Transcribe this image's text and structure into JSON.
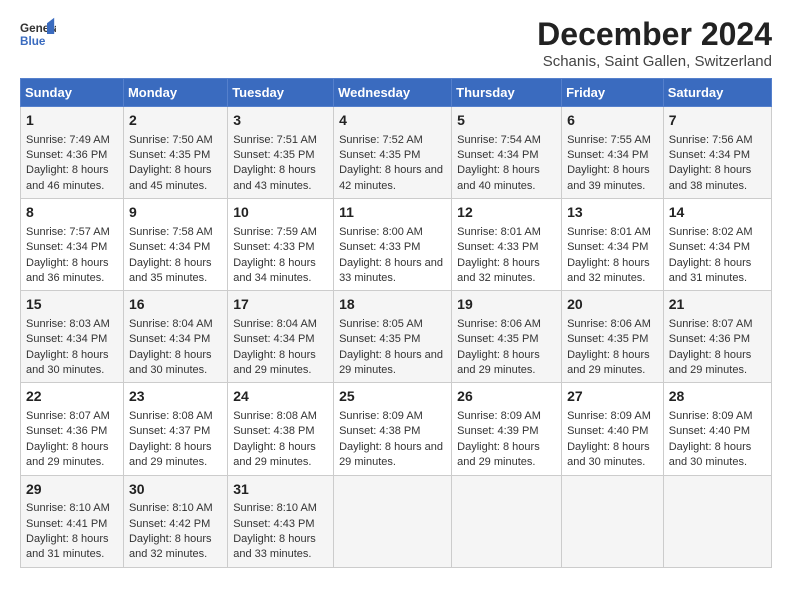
{
  "logo": {
    "text_general": "General",
    "text_blue": "Blue"
  },
  "title": "December 2024",
  "subtitle": "Schanis, Saint Gallen, Switzerland",
  "days_of_week": [
    "Sunday",
    "Monday",
    "Tuesday",
    "Wednesday",
    "Thursday",
    "Friday",
    "Saturday"
  ],
  "weeks": [
    [
      {
        "day": "1",
        "sunrise": "Sunrise: 7:49 AM",
        "sunset": "Sunset: 4:36 PM",
        "daylight": "Daylight: 8 hours and 46 minutes."
      },
      {
        "day": "2",
        "sunrise": "Sunrise: 7:50 AM",
        "sunset": "Sunset: 4:35 PM",
        "daylight": "Daylight: 8 hours and 45 minutes."
      },
      {
        "day": "3",
        "sunrise": "Sunrise: 7:51 AM",
        "sunset": "Sunset: 4:35 PM",
        "daylight": "Daylight: 8 hours and 43 minutes."
      },
      {
        "day": "4",
        "sunrise": "Sunrise: 7:52 AM",
        "sunset": "Sunset: 4:35 PM",
        "daylight": "Daylight: 8 hours and 42 minutes."
      },
      {
        "day": "5",
        "sunrise": "Sunrise: 7:54 AM",
        "sunset": "Sunset: 4:34 PM",
        "daylight": "Daylight: 8 hours and 40 minutes."
      },
      {
        "day": "6",
        "sunrise": "Sunrise: 7:55 AM",
        "sunset": "Sunset: 4:34 PM",
        "daylight": "Daylight: 8 hours and 39 minutes."
      },
      {
        "day": "7",
        "sunrise": "Sunrise: 7:56 AM",
        "sunset": "Sunset: 4:34 PM",
        "daylight": "Daylight: 8 hours and 38 minutes."
      }
    ],
    [
      {
        "day": "8",
        "sunrise": "Sunrise: 7:57 AM",
        "sunset": "Sunset: 4:34 PM",
        "daylight": "Daylight: 8 hours and 36 minutes."
      },
      {
        "day": "9",
        "sunrise": "Sunrise: 7:58 AM",
        "sunset": "Sunset: 4:34 PM",
        "daylight": "Daylight: 8 hours and 35 minutes."
      },
      {
        "day": "10",
        "sunrise": "Sunrise: 7:59 AM",
        "sunset": "Sunset: 4:33 PM",
        "daylight": "Daylight: 8 hours and 34 minutes."
      },
      {
        "day": "11",
        "sunrise": "Sunrise: 8:00 AM",
        "sunset": "Sunset: 4:33 PM",
        "daylight": "Daylight: 8 hours and 33 minutes."
      },
      {
        "day": "12",
        "sunrise": "Sunrise: 8:01 AM",
        "sunset": "Sunset: 4:33 PM",
        "daylight": "Daylight: 8 hours and 32 minutes."
      },
      {
        "day": "13",
        "sunrise": "Sunrise: 8:01 AM",
        "sunset": "Sunset: 4:34 PM",
        "daylight": "Daylight: 8 hours and 32 minutes."
      },
      {
        "day": "14",
        "sunrise": "Sunrise: 8:02 AM",
        "sunset": "Sunset: 4:34 PM",
        "daylight": "Daylight: 8 hours and 31 minutes."
      }
    ],
    [
      {
        "day": "15",
        "sunrise": "Sunrise: 8:03 AM",
        "sunset": "Sunset: 4:34 PM",
        "daylight": "Daylight: 8 hours and 30 minutes."
      },
      {
        "day": "16",
        "sunrise": "Sunrise: 8:04 AM",
        "sunset": "Sunset: 4:34 PM",
        "daylight": "Daylight: 8 hours and 30 minutes."
      },
      {
        "day": "17",
        "sunrise": "Sunrise: 8:04 AM",
        "sunset": "Sunset: 4:34 PM",
        "daylight": "Daylight: 8 hours and 29 minutes."
      },
      {
        "day": "18",
        "sunrise": "Sunrise: 8:05 AM",
        "sunset": "Sunset: 4:35 PM",
        "daylight": "Daylight: 8 hours and 29 minutes."
      },
      {
        "day": "19",
        "sunrise": "Sunrise: 8:06 AM",
        "sunset": "Sunset: 4:35 PM",
        "daylight": "Daylight: 8 hours and 29 minutes."
      },
      {
        "day": "20",
        "sunrise": "Sunrise: 8:06 AM",
        "sunset": "Sunset: 4:35 PM",
        "daylight": "Daylight: 8 hours and 29 minutes."
      },
      {
        "day": "21",
        "sunrise": "Sunrise: 8:07 AM",
        "sunset": "Sunset: 4:36 PM",
        "daylight": "Daylight: 8 hours and 29 minutes."
      }
    ],
    [
      {
        "day": "22",
        "sunrise": "Sunrise: 8:07 AM",
        "sunset": "Sunset: 4:36 PM",
        "daylight": "Daylight: 8 hours and 29 minutes."
      },
      {
        "day": "23",
        "sunrise": "Sunrise: 8:08 AM",
        "sunset": "Sunset: 4:37 PM",
        "daylight": "Daylight: 8 hours and 29 minutes."
      },
      {
        "day": "24",
        "sunrise": "Sunrise: 8:08 AM",
        "sunset": "Sunset: 4:38 PM",
        "daylight": "Daylight: 8 hours and 29 minutes."
      },
      {
        "day": "25",
        "sunrise": "Sunrise: 8:09 AM",
        "sunset": "Sunset: 4:38 PM",
        "daylight": "Daylight: 8 hours and 29 minutes."
      },
      {
        "day": "26",
        "sunrise": "Sunrise: 8:09 AM",
        "sunset": "Sunset: 4:39 PM",
        "daylight": "Daylight: 8 hours and 29 minutes."
      },
      {
        "day": "27",
        "sunrise": "Sunrise: 8:09 AM",
        "sunset": "Sunset: 4:40 PM",
        "daylight": "Daylight: 8 hours and 30 minutes."
      },
      {
        "day": "28",
        "sunrise": "Sunrise: 8:09 AM",
        "sunset": "Sunset: 4:40 PM",
        "daylight": "Daylight: 8 hours and 30 minutes."
      }
    ],
    [
      {
        "day": "29",
        "sunrise": "Sunrise: 8:10 AM",
        "sunset": "Sunset: 4:41 PM",
        "daylight": "Daylight: 8 hours and 31 minutes."
      },
      {
        "day": "30",
        "sunrise": "Sunrise: 8:10 AM",
        "sunset": "Sunset: 4:42 PM",
        "daylight": "Daylight: 8 hours and 32 minutes."
      },
      {
        "day": "31",
        "sunrise": "Sunrise: 8:10 AM",
        "sunset": "Sunset: 4:43 PM",
        "daylight": "Daylight: 8 hours and 33 minutes."
      },
      null,
      null,
      null,
      null
    ]
  ]
}
